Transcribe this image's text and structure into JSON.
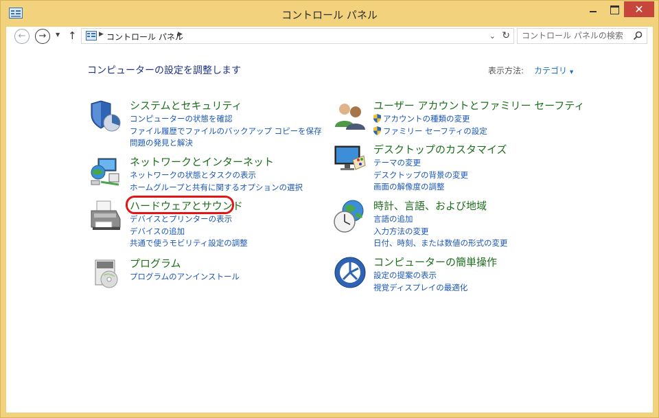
{
  "window": {
    "title": "コントロール パネル"
  },
  "navigation": {
    "back_icon": "back-arrow-icon",
    "forward_icon": "forward-arrow-icon",
    "up_icon": "up-arrow-icon",
    "breadcrumb": "コントロール パネル",
    "search_placeholder": "コントロール パネルの検索"
  },
  "main": {
    "heading": "コンピューターの設定を調整します",
    "view_by_label": "表示方法:",
    "view_by_value": "カテゴリ"
  },
  "categories": [
    {
      "title": "システムとセキュリティ",
      "icon": "shield-pie-icon",
      "links": [
        "コンピューターの状態を確認",
        "ファイル履歴でファイルのバックアップ コピーを保存",
        "問題の発見と解決"
      ]
    },
    {
      "title": "ネットワークとインターネット",
      "icon": "network-globe-icon",
      "links": [
        "ネットワークの状態とタスクの表示",
        "ホームグループと共有に関するオプションの選択"
      ]
    },
    {
      "title": "ハードウェアとサウンド",
      "icon": "printer-icon",
      "links": [
        "デバイスとプリンターの表示",
        "デバイスの追加",
        "共通で使うモビリティ設定の調整"
      ]
    },
    {
      "title": "プログラム",
      "icon": "programs-disc-icon",
      "links": [
        "プログラムのアンインストール"
      ]
    },
    {
      "title": "ユーザー アカウントとファミリー セーフティ",
      "icon": "users-icon",
      "links": [
        "アカウントの種類の変更",
        "ファミリー セーフティの設定"
      ]
    },
    {
      "title": "デスクトップのカスタマイズ",
      "icon": "monitor-palette-icon",
      "links": [
        "テーマの変更",
        "デスクトップの背景の変更",
        "画面の解像度の調整"
      ]
    },
    {
      "title": "時計、言語、および地域",
      "icon": "clock-globe-icon",
      "links": [
        "言語の追加",
        "入力方法の変更",
        "日付、時刻、または数値の形式の変更"
      ]
    },
    {
      "title": "コンピューターの簡単操作",
      "icon": "ease-of-access-icon",
      "links": [
        "設定の提案の表示",
        "視覚ディスプレイの最適化"
      ]
    }
  ],
  "colors": {
    "frame": "#f2d27c",
    "close_button": "#c7463c",
    "heading": "#1e3287",
    "category_title": "#1c6e1c",
    "link": "#1a56b8",
    "highlight": "#e31414"
  }
}
